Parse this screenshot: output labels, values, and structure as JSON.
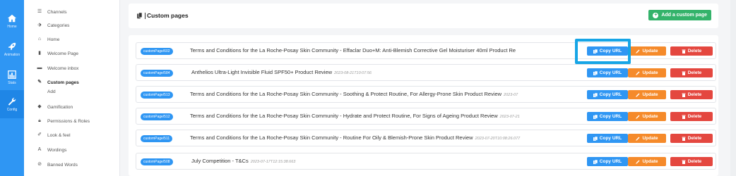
{
  "rail": [
    {
      "label": "Home",
      "icon": "home-icon"
    },
    {
      "label": "Animation",
      "icon": "rocket-icon"
    },
    {
      "label": "Stats",
      "icon": "bar-chart-icon"
    },
    {
      "label": "Config",
      "icon": "wrench-icon",
      "active": true
    }
  ],
  "menu": {
    "items": [
      {
        "label": "Channels",
        "icon": "list-icon"
      },
      {
        "label": "Categories",
        "icon": "tag-icon"
      },
      {
        "label": "Home",
        "icon": "home-icon"
      },
      {
        "label": "Welcome Page",
        "icon": "file-icon"
      },
      {
        "label": "Welcome inbox",
        "icon": "message-icon"
      },
      {
        "label": "Custom pages",
        "icon": "pencil-icon",
        "bold": true
      },
      {
        "label": "Gamification",
        "icon": "chat-icon"
      },
      {
        "label": "Permissions & Roles",
        "icon": "lock-icon"
      },
      {
        "label": "Look & feel",
        "icon": "brush-icon"
      },
      {
        "label": "Wordings",
        "icon": "text-icon"
      },
      {
        "label": "Banned Words",
        "icon": "ban-icon"
      }
    ],
    "sub_add": "Add"
  },
  "header": {
    "title": "Custom pages",
    "add_button": "Add a custom page"
  },
  "buttons": {
    "copy": "Copy URL",
    "update": "Update",
    "delete": "Delete"
  },
  "rows": [
    {
      "tag": "customPage/602",
      "title": "Terms and Conditions for the La Roche-Posay Skin Community - Effaclar Duo+M: Anti-Blemish Corrective Gel Moisturiser 40ml Product Re",
      "date": ""
    },
    {
      "tag": "customPage/584",
      "title": "Anthelios Ultra-Light Invisible Fluid SPF50+ Product Review",
      "date": "2023-08-21T10:07:56"
    },
    {
      "tag": "customPage/513",
      "title": "Terms and Conditions for the La Roche-Posay Skin Community - Soothing & Protect Routine, For Allergy-Prone Skin Product Review",
      "date": "2023-07"
    },
    {
      "tag": "customPage/512",
      "title": "Terms and Conditions for the La Roche-Posay Skin Community - Hydrate and Protect Routine, For Signs of Ageing Product Review",
      "date": "2023-07-21"
    },
    {
      "tag": "customPage/511",
      "title": "Terms and Conditions for the La Roche-Posay Skin Community - Routine For Oily & Blemish-Prone Skin Product Review",
      "date": "2023-07-20T10:08:26.077"
    },
    {
      "tag": "customPage/508",
      "title": "July Competition - T&Cs",
      "date": "2023-07-17T12:15:38.663"
    }
  ],
  "colors": {
    "primary": "#2f96f3",
    "success": "#34b36b",
    "warning": "#f58a2a",
    "danger": "#e4473f",
    "highlight": "#16a5e6"
  }
}
